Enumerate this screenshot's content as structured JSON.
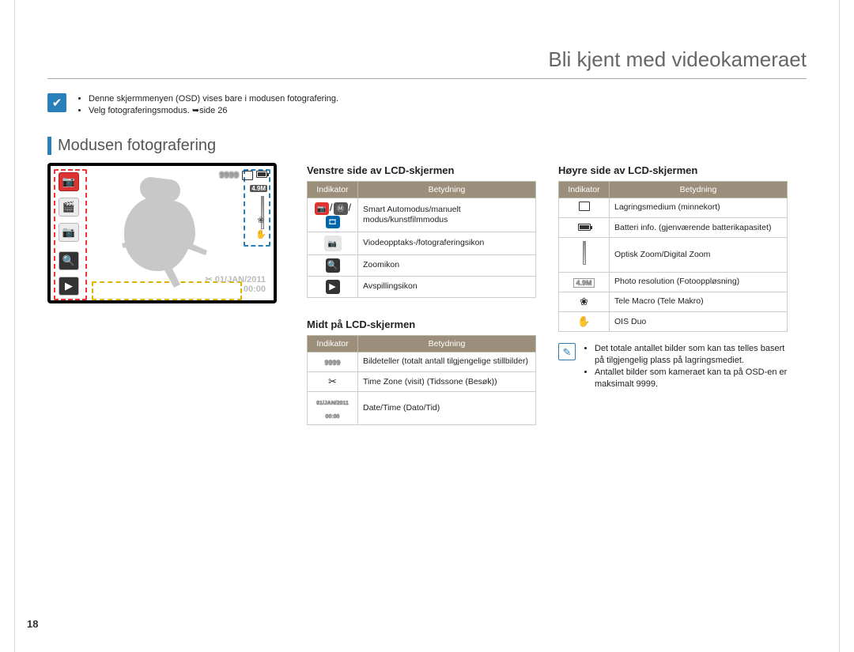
{
  "header": {
    "title": "Bli kjent med videokameraet"
  },
  "intro": {
    "line1": "Denne skjermmenyen (OSD) vises bare i modusen fotografering.",
    "line2": "Velg fotograferingsmodus. ➥side 26"
  },
  "section_title": "Modusen fotografering",
  "lcd": {
    "counter": "9999",
    "resolution": "4.9M",
    "date": "01/JAN/2011",
    "time": "00:00",
    "timezone_icon": "✂"
  },
  "left_table": {
    "heading": "Venstre side av LCD-skjermen",
    "th_indicator": "Indikator",
    "th_meaning": "Betydning",
    "rows": [
      {
        "icon": "modes",
        "text": "Smart Automodus/manuelt modus/kunstfilmmodus"
      },
      {
        "icon": "camera",
        "text": "Viodeopptaks-/fotograferingsikon"
      },
      {
        "icon": "zoom",
        "text": "Zoomikon"
      },
      {
        "icon": "play",
        "text": "Avspillingsikon"
      }
    ]
  },
  "mid_table": {
    "heading": "Midt på LCD-skjermen",
    "th_indicator": "Indikator",
    "th_meaning": "Betydning",
    "rows": [
      {
        "icon": "9999",
        "text": "Bildeteller (totalt antall tilgjengelige stillbilder)"
      },
      {
        "icon": "tz",
        "text": "Time Zone (visit) (Tidssone (Besøk))"
      },
      {
        "icon": "dt",
        "text": "Date/Time (Dato/Tid)"
      }
    ]
  },
  "right_table": {
    "heading": "Høyre side av LCD-skjermen",
    "th_indicator": "Indikator",
    "th_meaning": "Betydning",
    "rows": [
      {
        "icon": "card",
        "text": "Lagringsmedium (minnekort)"
      },
      {
        "icon": "batt",
        "text": "Batteri info. (gjenværende batterikapasitet)"
      },
      {
        "icon": "zoombar",
        "text": "Optisk Zoom/Digital Zoom"
      },
      {
        "icon": "res",
        "text": "Photo resolution (Fotooppløsning)"
      },
      {
        "icon": "macro",
        "text": "Tele Macro (Tele Makro)"
      },
      {
        "icon": "ois",
        "text": "OIS Duo"
      }
    ]
  },
  "notes": {
    "line1": "Det totale antallet bilder som kan tas telles basert på tilgjengelig plass på lagringsmediet.",
    "line2": "Antallet bilder som kameraet kan ta på OSD-en er maksimalt 9999."
  },
  "page_number": "18"
}
